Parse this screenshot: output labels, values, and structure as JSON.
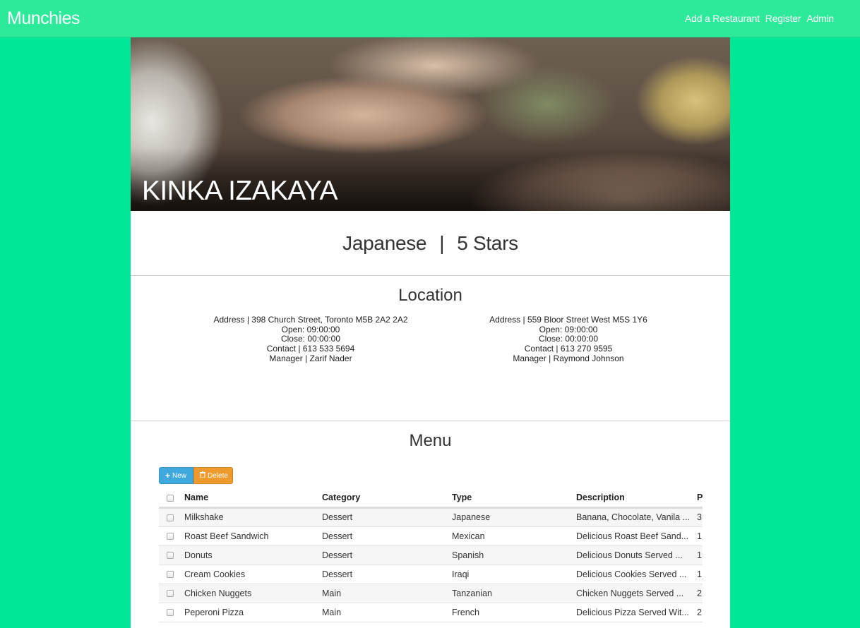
{
  "nav": {
    "brand": "Munchies",
    "links": [
      "Add a Restaurant",
      "Register",
      "Admin"
    ]
  },
  "restaurant": {
    "name": "KINKA IZAKAYA",
    "cuisine": "Japanese",
    "separator": "|",
    "rating": "5 Stars"
  },
  "location": {
    "heading": "Location",
    "branches": [
      {
        "address": "Address | 398 Church Street, Toronto M5B 2A2 2A2",
        "open": "Open: 09:00:00",
        "close": "Close: 00:00:00",
        "contact": "Contact | 613 533 5694",
        "manager": "Manager | Zarif Nader"
      },
      {
        "address": "Address | 559 Bloor Street West M5S 1Y6",
        "open": "Open: 09:00:00",
        "close": "Close: 00:00:00",
        "contact": "Contact | 613 270 9595",
        "manager": "Manager | Raymond Johnson"
      }
    ]
  },
  "menu": {
    "heading": "Menu",
    "new_label": "New",
    "delete_label": "Delete",
    "columns": [
      "Name",
      "Category",
      "Type",
      "Description",
      "P"
    ],
    "rows": [
      [
        "Milkshake",
        "Dessert",
        "Japanese",
        "Banana, Chocolate, Vanila ...",
        "3"
      ],
      [
        "Roast Beef Sandwich",
        "Dessert",
        "Mexican",
        "Delicious Roast Beef Sand...",
        "1"
      ],
      [
        "Donuts",
        "Dessert",
        "Spanish",
        "Delicious Donuts Served ...",
        "1"
      ],
      [
        "Cream Cookies",
        "Dessert",
        "Iraqi",
        "Delicious Cookies Served ...",
        "1"
      ],
      [
        "Chicken Nuggets",
        "Main",
        "Tanzanian",
        "Chicken Nuggets Served ...",
        "2"
      ],
      [
        "Peperoni Pizza",
        "Main",
        "French",
        "Delicious Pizza Served Wit...",
        "2"
      ]
    ]
  }
}
